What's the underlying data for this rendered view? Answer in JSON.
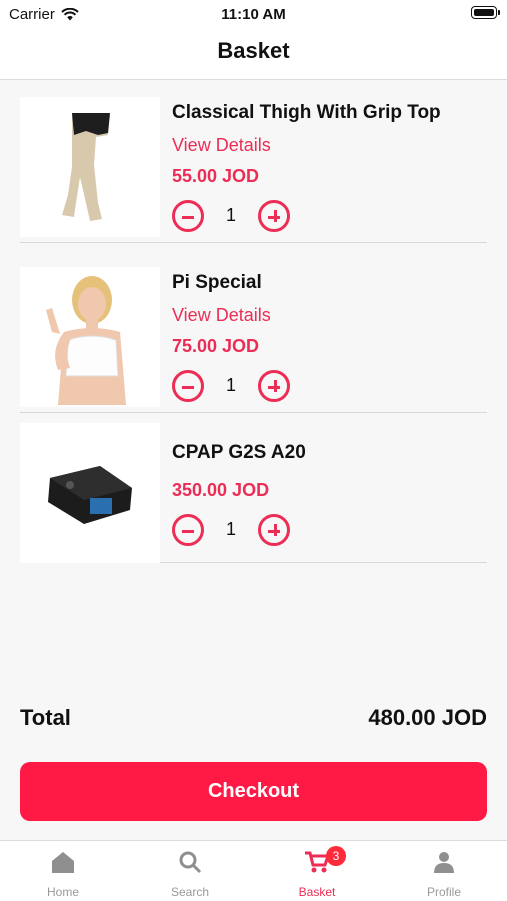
{
  "status_bar": {
    "carrier": "Carrier",
    "time": "11:10 AM"
  },
  "header": {
    "title": "Basket"
  },
  "items": [
    {
      "name": "Classical Thigh With Grip Top",
      "details_label": "View Details",
      "price": "55.00 JOD",
      "quantity": "1",
      "image_icon": "stocking-leg-image"
    },
    {
      "name": "Pi Special",
      "details_label": "View Details",
      "price": "75.00 JOD",
      "quantity": "1",
      "image_icon": "woman-bra-image"
    },
    {
      "name": "CPAP G2S A20",
      "price": "350.00 JOD",
      "quantity": "1",
      "image_icon": "cpap-device-image"
    }
  ],
  "summary": {
    "total_label": "Total",
    "total_value": "480.00 JOD"
  },
  "checkout": {
    "label": "Checkout"
  },
  "tabs": [
    {
      "label": "Home",
      "icon": "home-icon"
    },
    {
      "label": "Search",
      "icon": "search-icon"
    },
    {
      "label": "Basket",
      "icon": "cart-icon",
      "badge": "3",
      "active": true
    },
    {
      "label": "Profile",
      "icon": "profile-icon"
    }
  ],
  "colors": {
    "accent": "#ec2d55",
    "button": "#ff1a46",
    "badge": "#ff2a3a",
    "inactive_tab": "#999999"
  }
}
